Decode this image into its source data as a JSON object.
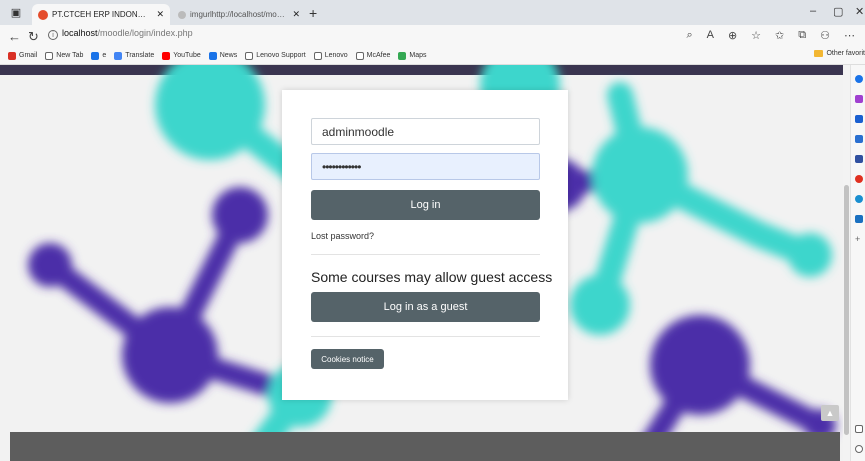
{
  "browser": {
    "tabs": [
      {
        "label": "PT.CTCEH ERP INDONESIA: Log",
        "active": true,
        "favicon_color": "#e44b2a"
      },
      {
        "label": "imgurlhttp://localhost/moodle/",
        "active": false,
        "favicon_color": "#8a8a8a"
      }
    ],
    "new_tab_glyph": "+",
    "window_controls": [
      "–",
      "▢",
      "✕"
    ],
    "address": {
      "host": "localhost",
      "path": "/moodle/login/index.php"
    },
    "bookmarks": [
      {
        "label": "Gmail",
        "icon": "gmail-icon",
        "color": "#d93025"
      },
      {
        "label": "New Tab",
        "icon": "page-icon",
        "color": "#888888"
      },
      {
        "label": "e",
        "icon": "drive-icon",
        "color": "#1a73e8"
      },
      {
        "label": "Translate",
        "icon": "translate-icon",
        "color": "#4285f4"
      },
      {
        "label": "YouTube",
        "icon": "youtube-icon",
        "color": "#ff0000"
      },
      {
        "label": "News",
        "icon": "news-icon",
        "color": "#1a73e8"
      },
      {
        "label": "Lenovo Support",
        "icon": "page-icon",
        "color": "#888888"
      },
      {
        "label": "Lenovo",
        "icon": "page-icon",
        "color": "#888888"
      },
      {
        "label": "McAfee",
        "icon": "page-icon",
        "color": "#888888"
      },
      {
        "label": "Maps",
        "icon": "maps-icon",
        "color": "#34a853"
      }
    ],
    "other_favorites": "Other favorit"
  },
  "login": {
    "username_value": "adminmoodle",
    "password_value": "••••••••••••",
    "login_button": "Log in",
    "lost_password": "Lost password?",
    "guest_heading": "Some courses may allow guest access",
    "guest_button": "Log in as a guest",
    "cookies_button": "Cookies notice"
  },
  "colors": {
    "button": "#556369",
    "teal": "#3dd6cc",
    "purple": "#4b2fa8"
  }
}
